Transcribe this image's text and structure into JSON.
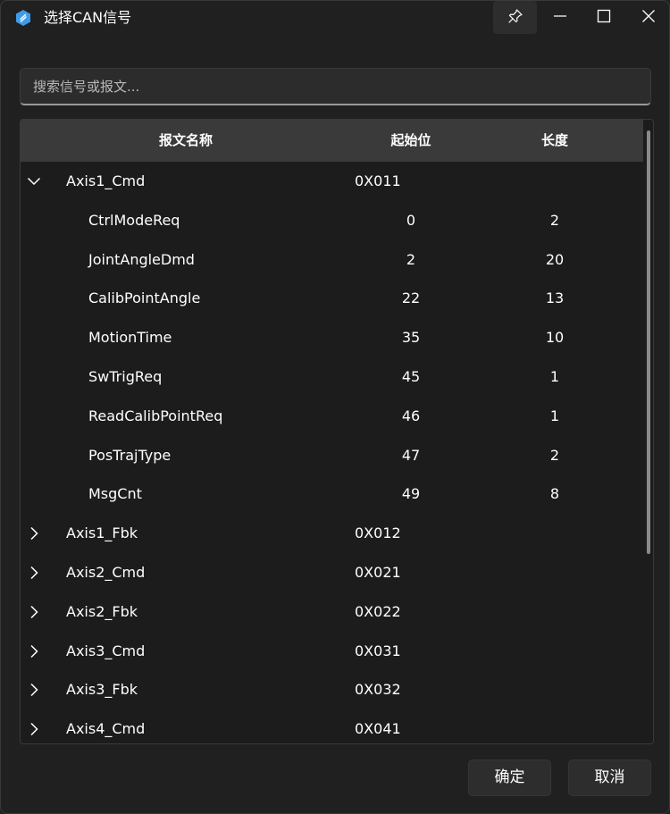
{
  "window": {
    "title": "选择CAN信号"
  },
  "search": {
    "placeholder": "搜索信号或报文..."
  },
  "table": {
    "headers": {
      "name": "报文名称",
      "start": "起始位",
      "length": "长度"
    },
    "messages": [
      {
        "name": "Axis1_Cmd",
        "id": "0X011",
        "expanded": true,
        "signals": [
          {
            "name": "CtrlModeReq",
            "start": "0",
            "length": "2"
          },
          {
            "name": "JointAngleDmd",
            "start": "2",
            "length": "20"
          },
          {
            "name": "CalibPointAngle",
            "start": "22",
            "length": "13"
          },
          {
            "name": "MotionTime",
            "start": "35",
            "length": "10"
          },
          {
            "name": "SwTrigReq",
            "start": "45",
            "length": "1"
          },
          {
            "name": "ReadCalibPointReq",
            "start": "46",
            "length": "1"
          },
          {
            "name": "PosTrajType",
            "start": "47",
            "length": "2"
          },
          {
            "name": "MsgCnt",
            "start": "49",
            "length": "8"
          }
        ]
      },
      {
        "name": "Axis1_Fbk",
        "id": "0X012",
        "expanded": false
      },
      {
        "name": "Axis2_Cmd",
        "id": "0X021",
        "expanded": false
      },
      {
        "name": "Axis2_Fbk",
        "id": "0X022",
        "expanded": false
      },
      {
        "name": "Axis3_Cmd",
        "id": "0X031",
        "expanded": false
      },
      {
        "name": "Axis3_Fbk",
        "id": "0X032",
        "expanded": false
      },
      {
        "name": "Axis4_Cmd",
        "id": "0X041",
        "expanded": false
      }
    ]
  },
  "buttons": {
    "ok": "确定",
    "cancel": "取消"
  },
  "icons": {
    "app": "app-logo-icon",
    "pin": "pin-icon",
    "minimize": "minimize-icon",
    "maximize": "maximize-icon",
    "close": "close-icon",
    "expanded": "chevron-down-icon",
    "collapsed": "chevron-right-icon"
  },
  "colors": {
    "background": "#202020",
    "header": "#3a3a3a",
    "accent": "#3d9be9"
  }
}
